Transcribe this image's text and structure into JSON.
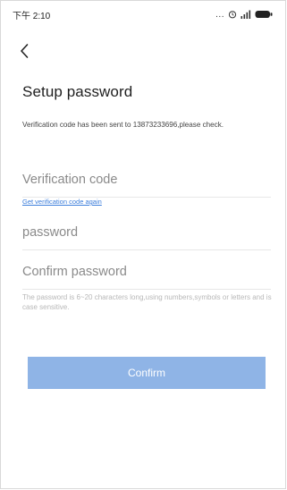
{
  "status_bar": {
    "time": "下午 2:10",
    "more": "..."
  },
  "header": {
    "back_icon": "back-chevron-icon"
  },
  "content": {
    "title": "Setup password",
    "verify_info": "Verification code has been sent to 13873233696,please check.",
    "verification_placeholder": "Verification code",
    "resend_link": "Get verification code again",
    "password_placeholder": "password",
    "confirm_password_placeholder": "Confirm password",
    "hint": "The password is 6~20 characters long,using numbers,symbols or letters and is case sensitive.",
    "confirm_button": "Confirm"
  },
  "colors": {
    "button": "#8fb4e6",
    "link": "#3b7ddb",
    "hint": "#b8b8b8"
  }
}
